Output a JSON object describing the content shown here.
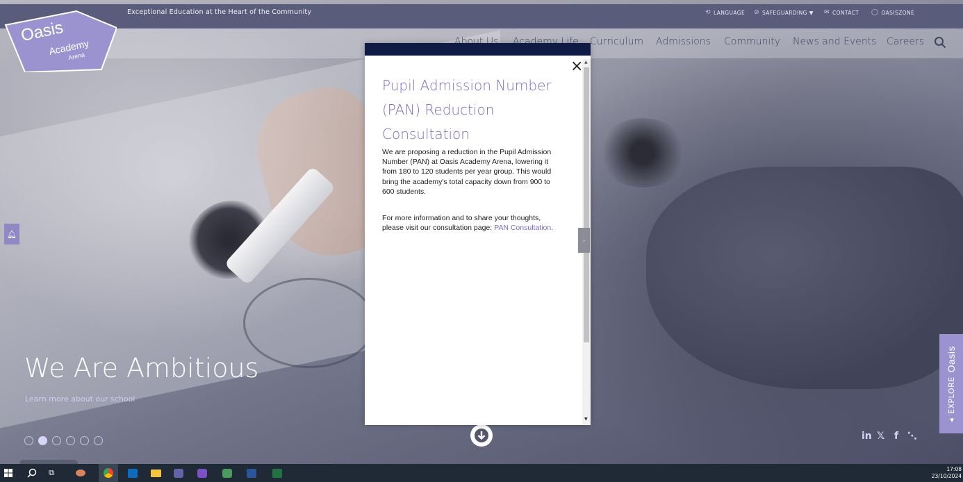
{
  "topbar": {
    "tagline": "Exceptional Education at the Heart of the Community",
    "utility": [
      {
        "label": "LANGUAGE",
        "icon": "translate-icon"
      },
      {
        "label": "SAFEGUARDING ▼",
        "icon": "safeguarding-icon"
      },
      {
        "label": "CONTACT",
        "icon": "mail-icon"
      },
      {
        "label": "OASISZONE",
        "icon": "oasis-icon"
      }
    ]
  },
  "logo": {
    "line1": "Oasis",
    "line2": "Academy",
    "line3": "Arena"
  },
  "nav": {
    "items": [
      "About Us",
      "Academy Life",
      "Curriculum",
      "Admissions",
      "Community",
      "News and Events",
      "Careers"
    ]
  },
  "hero": {
    "title": "We Are Ambitious",
    "subtitle": "Learn more about our school",
    "slide_count": 6,
    "active_slide": 2
  },
  "modal": {
    "title": "Pupil Admission Number (PAN) Reduction Consultation",
    "paragraph1": "We are proposing a reduction in the Pupil Admission Number (PAN) at Oasis Academy Arena, lowering it from 180 to 120 students per year group. This would bring the academy's total capacity down from 900 to 600 students.",
    "paragraph2_text": "For more information and to share your thoughts, please visit our consultation page: ",
    "paragraph2_link": "PAN Consultation",
    "paragraph2_end": ".",
    "close_label": "×"
  },
  "explore": {
    "label": "EXPLORE",
    "brand": "Oasis"
  },
  "social": [
    "in",
    "𝕏",
    "f",
    "⋱"
  ],
  "taskbar": {
    "time": "17:08",
    "date": "23/10/2024"
  },
  "colors": {
    "accent": "#7a6dc1",
    "topbar": "#5a5c7b",
    "modal_header": "#0f1a45",
    "explore_tab": "#9b93cf",
    "taskbar": "#1f2a36"
  }
}
